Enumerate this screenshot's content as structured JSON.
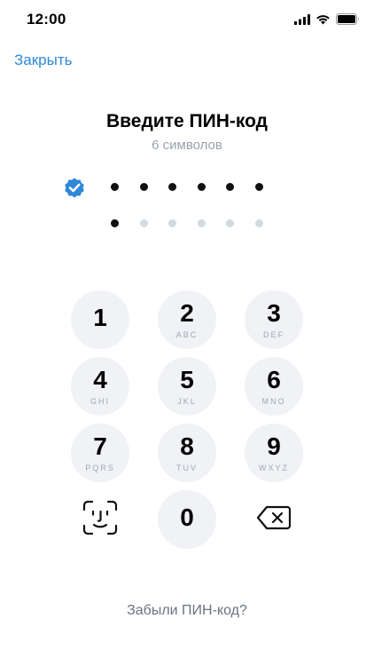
{
  "status_bar": {
    "time": "12:00",
    "icons": [
      "cellular-signal-icon",
      "wifi-icon",
      "battery-icon"
    ]
  },
  "header": {
    "close_label": "Закрыть"
  },
  "pin": {
    "title": "Введите ПИН-код",
    "subtitle": "6 символов",
    "first_row": {
      "verified": true,
      "filled": 6,
      "total": 6
    },
    "second_row": {
      "filled": 1,
      "total": 6
    }
  },
  "keypad": {
    "keys": [
      {
        "digit": "1",
        "letters": ""
      },
      {
        "digit": "2",
        "letters": "ABC"
      },
      {
        "digit": "3",
        "letters": "DEF"
      },
      {
        "digit": "4",
        "letters": "GHI"
      },
      {
        "digit": "5",
        "letters": "JKL"
      },
      {
        "digit": "6",
        "letters": "MNO"
      },
      {
        "digit": "7",
        "letters": "PQRS"
      },
      {
        "digit": "8",
        "letters": "TUV"
      },
      {
        "digit": "9",
        "letters": "WXYZ"
      },
      {
        "digit": "0",
        "letters": ""
      }
    ],
    "left_action_icon": "face-id-icon",
    "right_action_icon": "backspace-icon"
  },
  "footer": {
    "forgot_label": "Забыли ПИН-код?"
  },
  "colors": {
    "accent": "#2f88d8",
    "key_background": "#f0f2f5",
    "dot_filled": "#111111",
    "dot_empty": "#d3d9e1",
    "muted_text": "#9aa2ad"
  }
}
